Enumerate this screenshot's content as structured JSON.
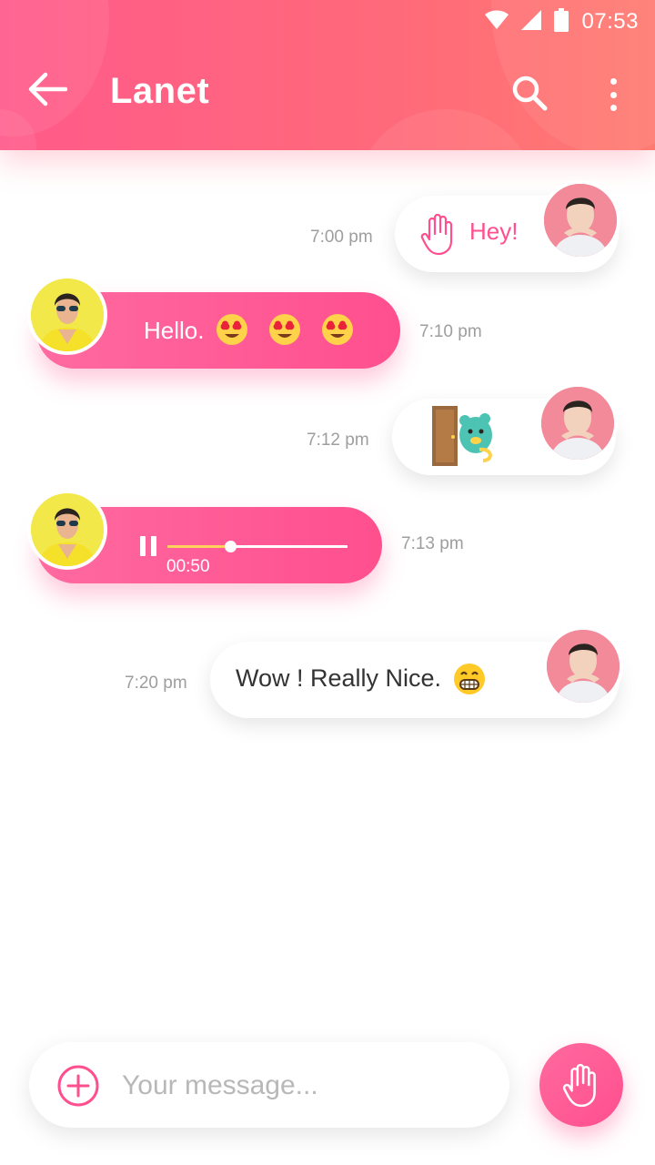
{
  "status_bar": {
    "time": "07:53",
    "icons": [
      "wifi-icon",
      "signal-icon",
      "battery-icon"
    ]
  },
  "header": {
    "title": "Lanet",
    "back_icon": "arrow-left-icon",
    "search_icon": "search-icon",
    "more_icon": "more-vertical-icon"
  },
  "colors": {
    "accent": "#ff4f8e",
    "header_start": "#ff5a8a",
    "header_end": "#ff7a70",
    "voice_progress": "#ffd25e"
  },
  "messages": [
    {
      "direction": "outgoing",
      "type": "text",
      "icon": "waving-hand-icon",
      "text": "Hey!",
      "time": "7:00 pm"
    },
    {
      "direction": "incoming",
      "type": "text",
      "text": "Hello.",
      "emojis": [
        "heart-eyes-emoji",
        "heart-eyes-emoji",
        "heart-eyes-emoji"
      ],
      "time": "7:10 pm"
    },
    {
      "direction": "outgoing",
      "type": "sticker",
      "sticker": "door-peek-sticker",
      "time": "7:12 pm"
    },
    {
      "direction": "incoming",
      "type": "voice",
      "duration": "00:50",
      "progress": 0.35,
      "time": "7:13 pm"
    },
    {
      "direction": "outgoing",
      "type": "text",
      "text": "Wow ! Really Nice.",
      "emojis": [
        "grinning-emoji"
      ],
      "time": "7:20 pm"
    }
  ],
  "composer": {
    "placeholder": "Your message...",
    "value": "",
    "add_icon": "plus-circle-icon",
    "send_icon": "waving-hand-icon"
  }
}
